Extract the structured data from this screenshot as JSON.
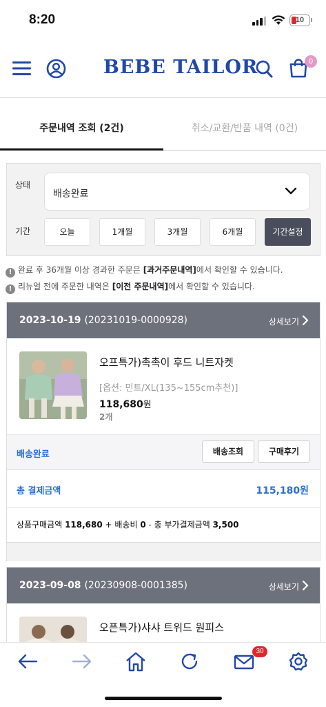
{
  "status_bar": {
    "time": "8:20",
    "battery": "10"
  },
  "header": {
    "logo": "BEBE TAILOR",
    "cart_count": "0"
  },
  "tabs": {
    "orders": "주문내역 조회  (2건)",
    "returns": "취소/교환/반품 내역  (0건)"
  },
  "filter": {
    "status_label": "상태",
    "status_value": "배송완료",
    "period_label": "기간",
    "periods": [
      "오늘",
      "1개월",
      "3개월",
      "6개월",
      "기간설정"
    ]
  },
  "notices": {
    "n1_a": "완료 후 36개월 이상 경과한 주문은 ",
    "n1_b": "[과거주문내역]",
    "n1_c": "에서 확인할 수 있습니다.",
    "n2_a": "리뉴얼 전에 주문한 내역은 ",
    "n2_b": "[이전 주문내역]",
    "n2_c": "에서 확인할 수 있습니다."
  },
  "orders": [
    {
      "date": "2023-10-19",
      "order_no": "(20231019-0000928)",
      "detail_label": "상세보기",
      "product_name": "오프특가)촉촉이 후드 니트자켓",
      "option": "[옵션: 민트/XL(135~155cm추천)]",
      "price": "118,680",
      "price_unit": "원",
      "qty": "2개",
      "status": "배송완료",
      "track_button": "배송조회",
      "review_button": "구매후기",
      "total_label": "총 결제금액",
      "total_value": "115,180원",
      "summary_a": "상품구매금액 ",
      "summary_b": "118,680",
      "summary_c": " + 배송비 ",
      "summary_d": "0",
      "summary_e": " - 총 부가결제금액 ",
      "summary_f": "3,500"
    },
    {
      "date": "2023-09-08",
      "order_no": "(20230908-0001385)",
      "detail_label": "상세보기",
      "product_name": "오픈특가)샤샤 트위드 원피스"
    }
  ],
  "bottom_nav": {
    "mail_badge": "30"
  },
  "colors": {
    "brand": "#2048a8",
    "accent_blue": "#2a6fd6",
    "header_gray": "#6d717c",
    "dark_button": "#4a4e5c"
  }
}
